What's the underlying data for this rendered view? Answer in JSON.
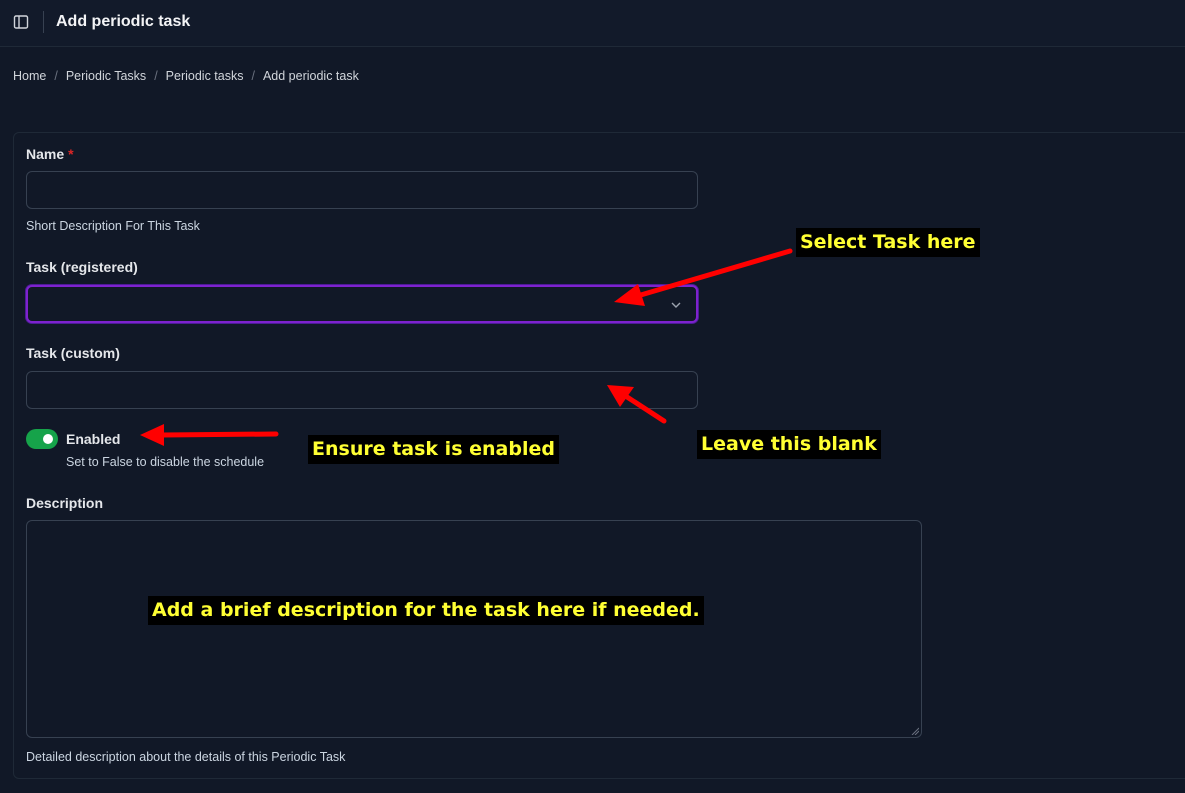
{
  "header": {
    "title": "Add periodic task",
    "sidebar_toggle_icon": "sidebar-panel-icon"
  },
  "breadcrumb": {
    "items": [
      "Home",
      "Periodic Tasks",
      "Periodic tasks",
      "Add periodic task"
    ],
    "separator": "/"
  },
  "form": {
    "name": {
      "label": "Name",
      "required_marker": "*",
      "value": "",
      "help": "Short Description For This Task"
    },
    "task_registered": {
      "label": "Task (registered)",
      "selected": "",
      "icon": "chevron-down-icon"
    },
    "task_custom": {
      "label": "Task (custom)",
      "value": ""
    },
    "enabled": {
      "label": "Enabled",
      "checked": true,
      "help": "Set to False to disable the schedule"
    },
    "description": {
      "label": "Description",
      "value": "",
      "help": "Detailed description about the details of this Periodic Task"
    }
  },
  "annotations": {
    "select_task": "Select Task here",
    "leave_blank": "Leave this blank",
    "ensure_enabled": "Ensure task is enabled",
    "description_hint": "Add a brief description for the task here if needed."
  },
  "colors": {
    "background": "#111827",
    "focus_border": "#7e22ce",
    "toggle_on": "#16a34a",
    "required": "#dc2626",
    "annotation_text": "#ffff33",
    "arrow": "#ff0000"
  }
}
